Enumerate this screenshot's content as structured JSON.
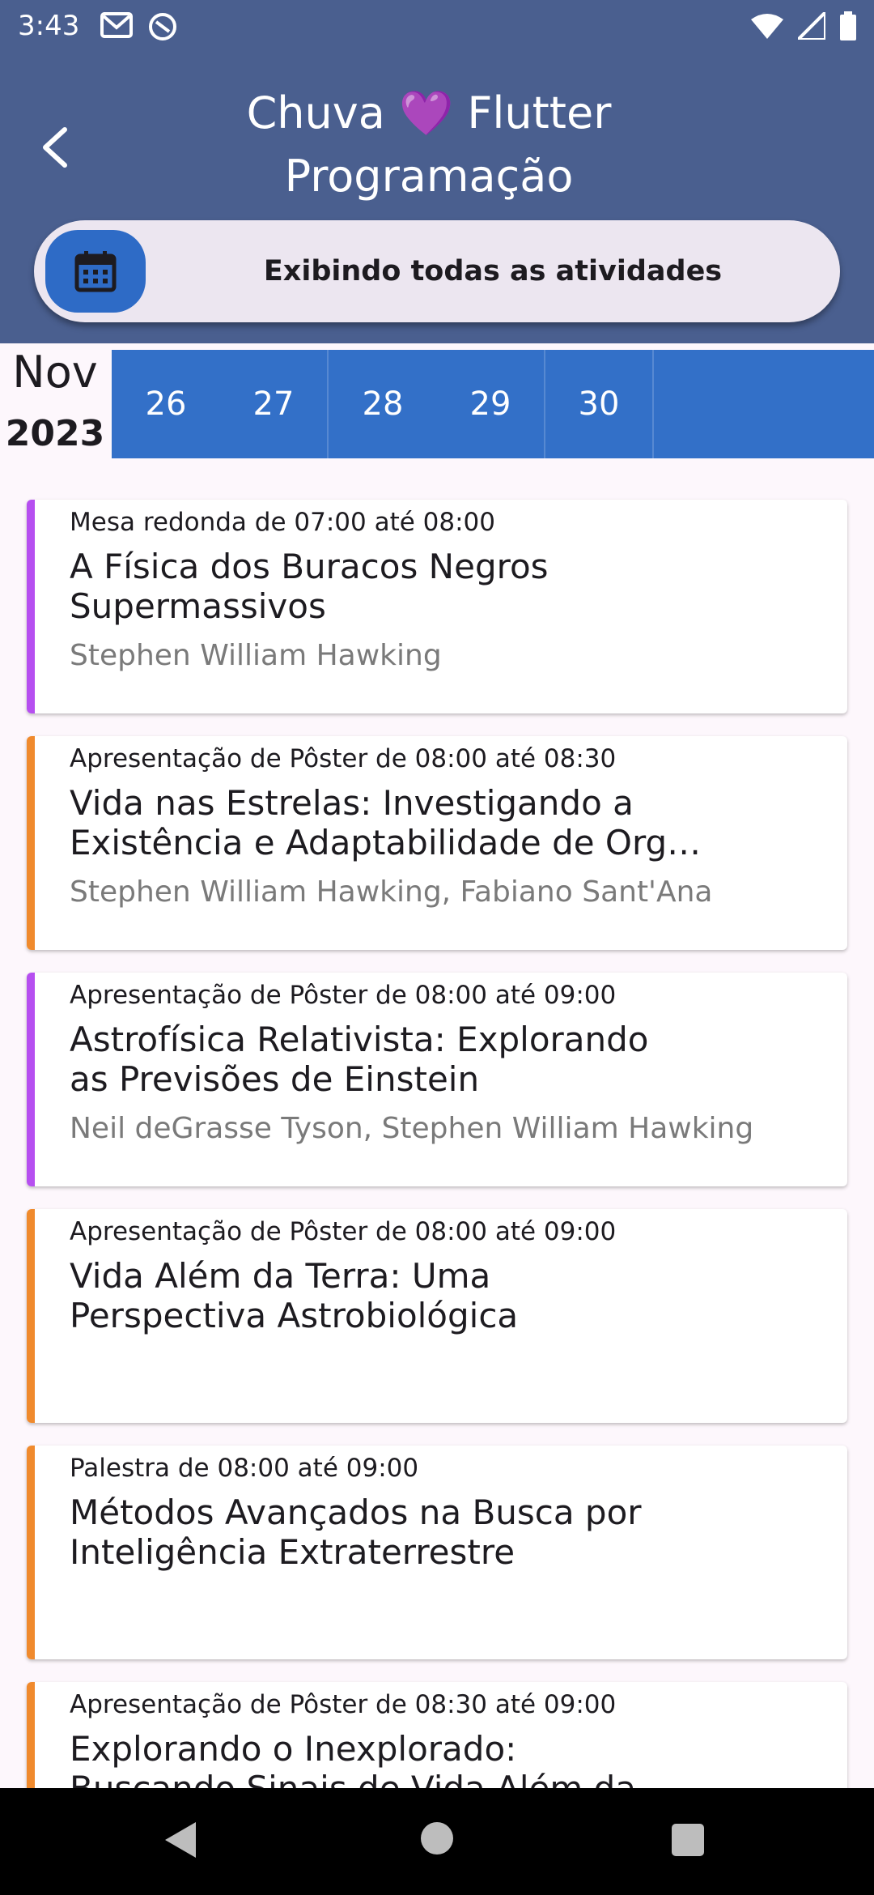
{
  "status_bar": {
    "time": "3:43"
  },
  "header": {
    "title_line1": "Chuva 💜 Flutter",
    "title_line2": "Programação"
  },
  "filter": {
    "label": "Exibindo todas as atividades"
  },
  "date": {
    "month": "Nov",
    "year": "2023",
    "days": [
      "26",
      "27",
      "28",
      "29",
      "30"
    ]
  },
  "colors": {
    "appbar": "#4a5f8f",
    "days_bar": "#3370c8",
    "purple": "#b64ff0",
    "orange": "#f08a2d"
  },
  "activities": [
    {
      "type_time": "Mesa redonda de 07:00 até 08:00",
      "title_lines": [
        "A Física dos Buracos Negros",
        "Supermassivos"
      ],
      "speakers": "Stephen William Hawking",
      "color": "#b64ff0"
    },
    {
      "type_time": "Apresentação de Pôster de 08:00 até 08:30",
      "title_lines": [
        "Vida nas Estrelas: Investigando a",
        "Existência e Adaptabilidade de Org…"
      ],
      "speakers": "Stephen William Hawking, Fabiano Sant'Ana",
      "color": "#f08a2d"
    },
    {
      "type_time": "Apresentação de Pôster de 08:00 até 09:00",
      "title_lines": [
        "Astrofísica Relativista: Explorando",
        "as Previsões de Einstein"
      ],
      "speakers": " Neil deGrasse Tyson, Stephen William Hawking",
      "color": "#b64ff0"
    },
    {
      "type_time": "Apresentação de Pôster de 08:00 até 09:00",
      "title_lines": [
        "Vida Além da Terra: Uma",
        "Perspectiva Astrobiológica"
      ],
      "speakers": "",
      "color": "#f08a2d"
    },
    {
      "type_time": "Palestra de 08:00 até 09:00",
      "title_lines": [
        "Métodos Avançados na Busca por",
        "Inteligência Extraterrestre"
      ],
      "speakers": "",
      "color": "#f08a2d"
    },
    {
      "type_time": "Apresentação de Pôster de 08:30 até 09:00",
      "title_lines": [
        "Explorando o Inexplorado:",
        "Buscando Sinais de Vida Além da"
      ],
      "speakers": "",
      "color": "#f08a2d"
    }
  ]
}
